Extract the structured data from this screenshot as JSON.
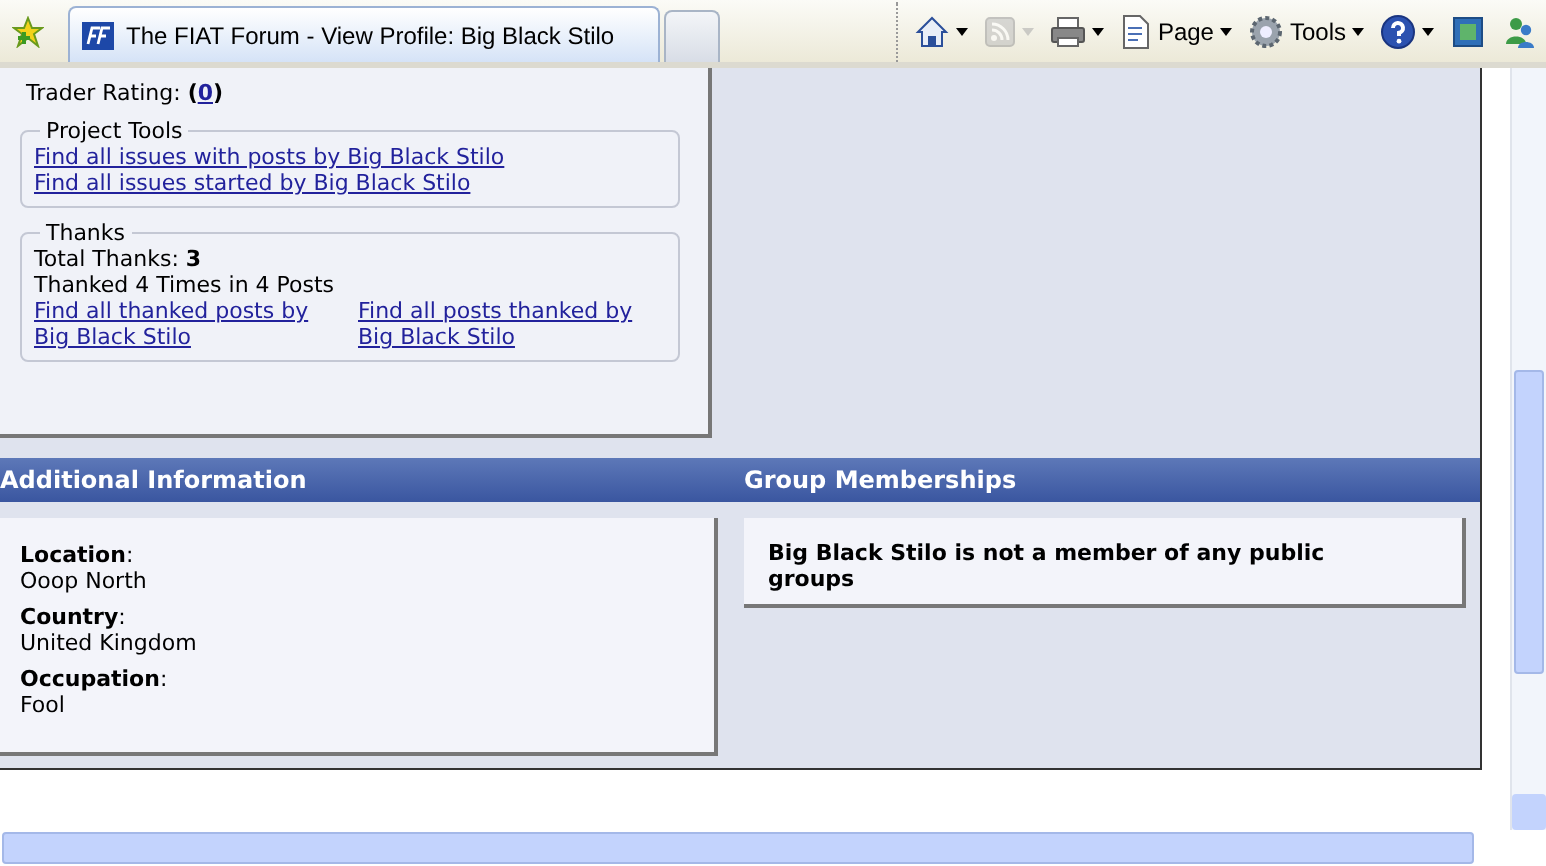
{
  "browser": {
    "tab_title": "The FIAT Forum - View Profile: Big Black Stilo",
    "toolbar": [
      {
        "kind": "home",
        "dropdown": true,
        "disabled": false
      },
      {
        "kind": "feeds",
        "dropdown": true,
        "disabled": true
      },
      {
        "kind": "print",
        "dropdown": true,
        "disabled": false
      },
      {
        "kind": "page",
        "label": "Page",
        "dropdown": true,
        "disabled": false
      },
      {
        "kind": "tools",
        "label": "Tools",
        "dropdown": true,
        "disabled": false
      },
      {
        "kind": "help",
        "dropdown": true,
        "disabled": false
      },
      {
        "kind": "research",
        "dropdown": false,
        "disabled": false
      },
      {
        "kind": "messenger",
        "dropdown": false,
        "disabled": false
      }
    ]
  },
  "profile": {
    "trader_rating": {
      "label": "Trader Rating:",
      "bracket_open": "(",
      "link": "0",
      "bracket_close": ")"
    },
    "project_tools": {
      "legend": "Project Tools",
      "links": [
        "Find all issues with posts by Big Black Stilo",
        "Find all issues started by Big Black Stilo"
      ]
    },
    "thanks": {
      "legend": "Thanks",
      "total": "Total Thanks: **3**",
      "thanked": "Thanked 4 Times in 4 Posts",
      "links": [
        "Find all thanked posts by Big Black Stilo",
        "Find all posts thanked by Big Black Stilo"
      ]
    },
    "additional_information": {
      "title": "Additional Information",
      "fields": [
        {
          "label": "**Location**:",
          "value": "Ooop North"
        },
        {
          "label": "**Country**:",
          "value": "United Kingdom"
        },
        {
          "label": "**Occupation**:",
          "value": "Fool"
        }
      ]
    },
    "group_memberships": {
      "title": "Group Memberships",
      "message": "Big Black Stilo is not a member of any public groups"
    }
  }
}
